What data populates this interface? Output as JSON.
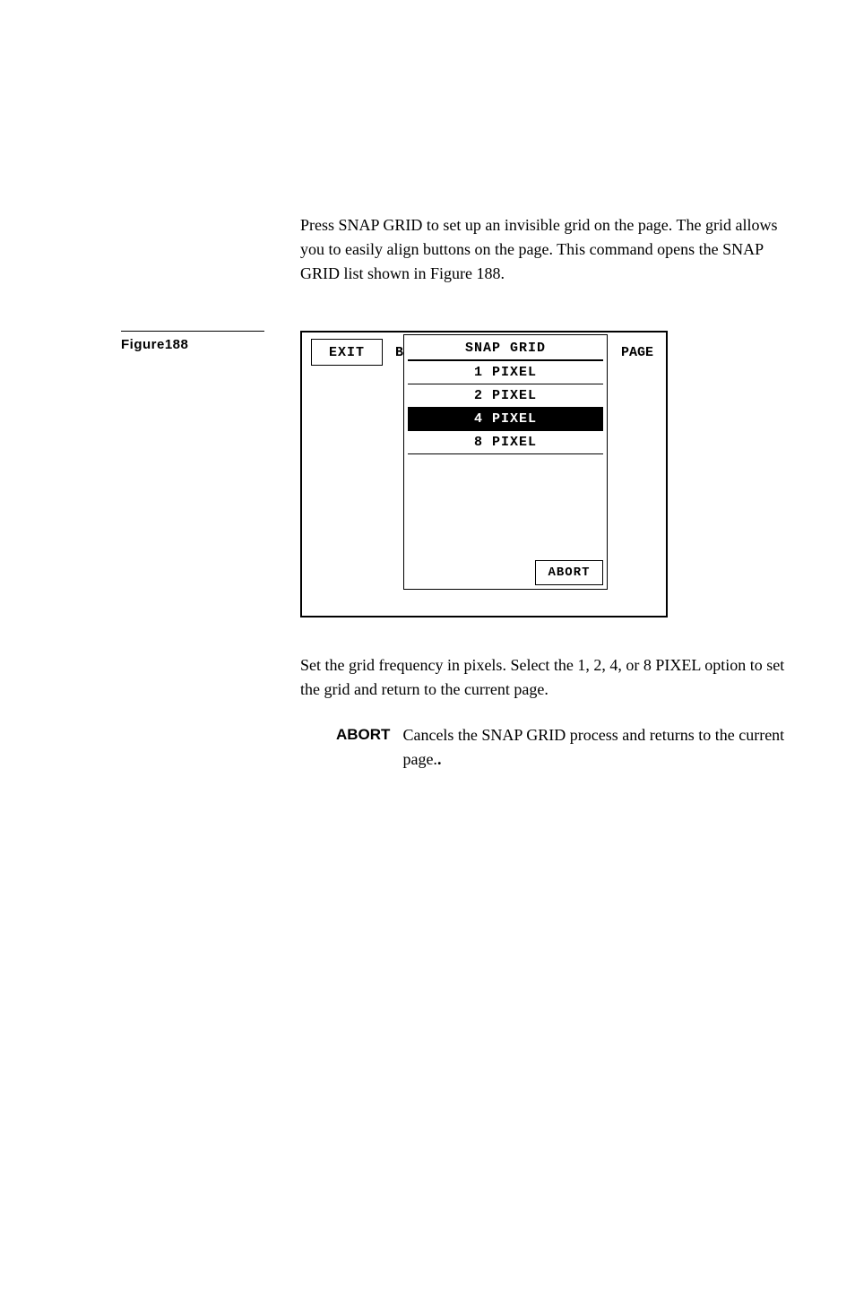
{
  "body": {
    "intro": "Press SNAP GRID to set up an invisible grid on the page. The grid allows you to easily align buttons on the page. This command opens the SNAP GRID list shown in Figure 188.",
    "set_freq": "Set the grid frequency in pixels. Select the 1, 2, 4, or 8 PIXEL option to set the grid and return to the current page.",
    "abort_label": "ABORT",
    "abort_def": "Cancels the SNAP GRID process and returns to the current page."
  },
  "figure": {
    "label": "Figure188",
    "top_row": {
      "exit": "EXIT",
      "bu": "BU",
      "page": "PAGE"
    },
    "list": {
      "title": "SNAP GRID",
      "items": [
        "1 PIXEL",
        "2 PIXEL",
        "4 PIXEL",
        "8 PIXEL"
      ],
      "selected_index": 2,
      "abort": "ABORT"
    }
  }
}
